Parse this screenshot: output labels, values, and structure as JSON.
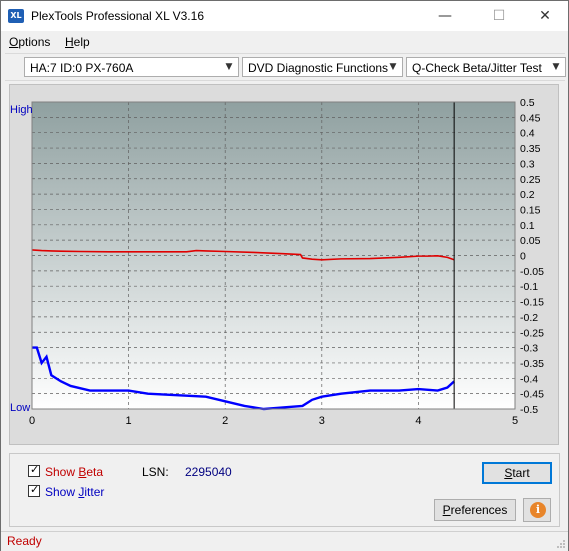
{
  "window": {
    "title": "PlexTools Professional XL V3.16",
    "app_icon_text": "XL",
    "minimize_glyph": "—",
    "maximize_glyph": "☐",
    "close_glyph": "✕"
  },
  "menu": {
    "options_first": "O",
    "options_rest": "ptions",
    "help_first": "H",
    "help_rest": "elp"
  },
  "toolbar": {
    "drive": "HA:7 ID:0  PX-760A",
    "function": "DVD Diagnostic Functions",
    "test": "Q-Check Beta/Jitter Test",
    "arrow_glyph": "▼"
  },
  "chart_data": {
    "type": "line",
    "left_axis_top_label": "High",
    "left_axis_bottom_label": "Low",
    "xlim": [
      0,
      5
    ],
    "x_ticks": [
      "0",
      "1",
      "2",
      "3",
      "4",
      "5"
    ],
    "ylim_right": [
      -0.5,
      0.5
    ],
    "y_ticks_right": [
      "0.5",
      "0.45",
      "0.4",
      "0.35",
      "0.3",
      "0.25",
      "0.2",
      "0.15",
      "0.1",
      "0.05",
      "0",
      "-0.05",
      "-0.1",
      "-0.15",
      "-0.2",
      "-0.25",
      "-0.3",
      "-0.35",
      "-0.4",
      "-0.45",
      "-0.5"
    ],
    "end_marker_x": 4.37,
    "grid": true,
    "colors": {
      "beta": "#e00000",
      "jitter": "#0000ff",
      "bg_top": "#8fa0a0",
      "bg_bottom": "#ffffff"
    },
    "series": [
      {
        "name": "Beta",
        "y_axis": "right",
        "x": [
          0,
          0.1,
          0.2,
          0.3,
          0.5,
          0.8,
          1.0,
          1.3,
          1.6,
          1.7,
          1.8,
          2.0,
          2.3,
          2.6,
          2.78,
          2.8,
          2.9,
          3.0,
          3.2,
          3.5,
          3.8,
          4.0,
          4.1,
          4.2,
          4.3,
          4.37
        ],
        "y": [
          0.018,
          0.016,
          0.015,
          0.014,
          0.013,
          0.012,
          0.012,
          0.012,
          0.012,
          0.016,
          0.015,
          0.013,
          0.01,
          0.006,
          0.003,
          -0.008,
          -0.012,
          -0.014,
          -0.011,
          -0.01,
          -0.006,
          -0.002,
          -0.002,
          -0.001,
          -0.006,
          -0.014
        ]
      },
      {
        "name": "Jitter",
        "y_axis": "left",
        "x": [
          0,
          0.05,
          0.1,
          0.15,
          0.2,
          0.3,
          0.4,
          0.6,
          0.8,
          1.0,
          1.2,
          1.5,
          1.8,
          2.0,
          2.2,
          2.4,
          2.6,
          2.8,
          2.9,
          3.0,
          3.2,
          3.5,
          3.8,
          4.0,
          4.2,
          4.3,
          4.37
        ],
        "y": [
          0.2,
          0.2,
          0.15,
          0.17,
          0.11,
          0.09,
          0.075,
          0.06,
          0.06,
          0.06,
          0.05,
          0.045,
          0.04,
          0.025,
          0.01,
          0.0,
          0.005,
          0.01,
          0.03,
          0.04,
          0.05,
          0.06,
          0.06,
          0.065,
          0.06,
          0.07,
          0.09
        ]
      }
    ]
  },
  "controls": {
    "show_beta_first": "Show ",
    "show_beta_key": "B",
    "show_beta_rest": "eta",
    "show_beta_checked": true,
    "show_jitter_first": "Show ",
    "show_jitter_key": "J",
    "show_jitter_rest": "itter",
    "show_jitter_checked": true,
    "check_glyph": "✓",
    "lsn_label": "LSN:",
    "lsn_value": "2295040",
    "start_key": "S",
    "start_rest": "tart",
    "preferences_key": "P",
    "preferences_rest": "references",
    "info_glyph": "i"
  },
  "status": {
    "text": "Ready"
  }
}
